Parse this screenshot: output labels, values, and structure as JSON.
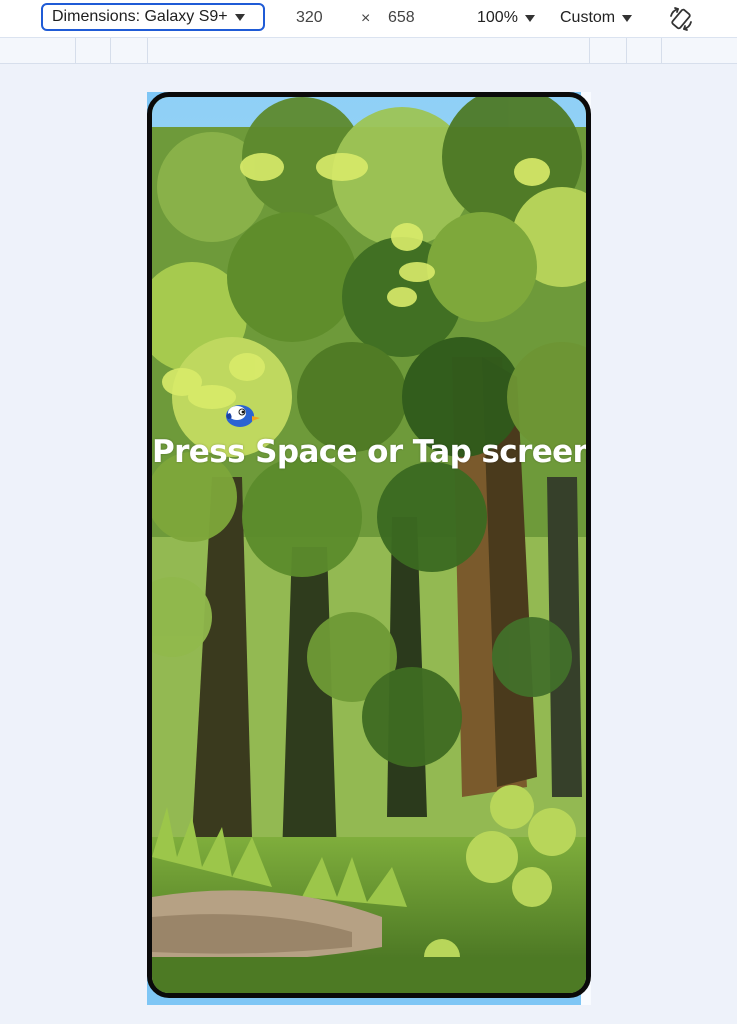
{
  "toolbar": {
    "device_label": "Dimensions: Galaxy S9+",
    "width": "320",
    "times": "×",
    "height": "658",
    "zoom": "100%",
    "throttle": "Custom",
    "rotate_icon": "rotate-icon"
  },
  "game": {
    "prompt": "Press Space or Tap screen!",
    "bird_icon": "bird-icon"
  },
  "colors": {
    "accent": "#1f5bd6",
    "prompt_text": "#ffffff",
    "device_frame": "#0a0a0a"
  }
}
